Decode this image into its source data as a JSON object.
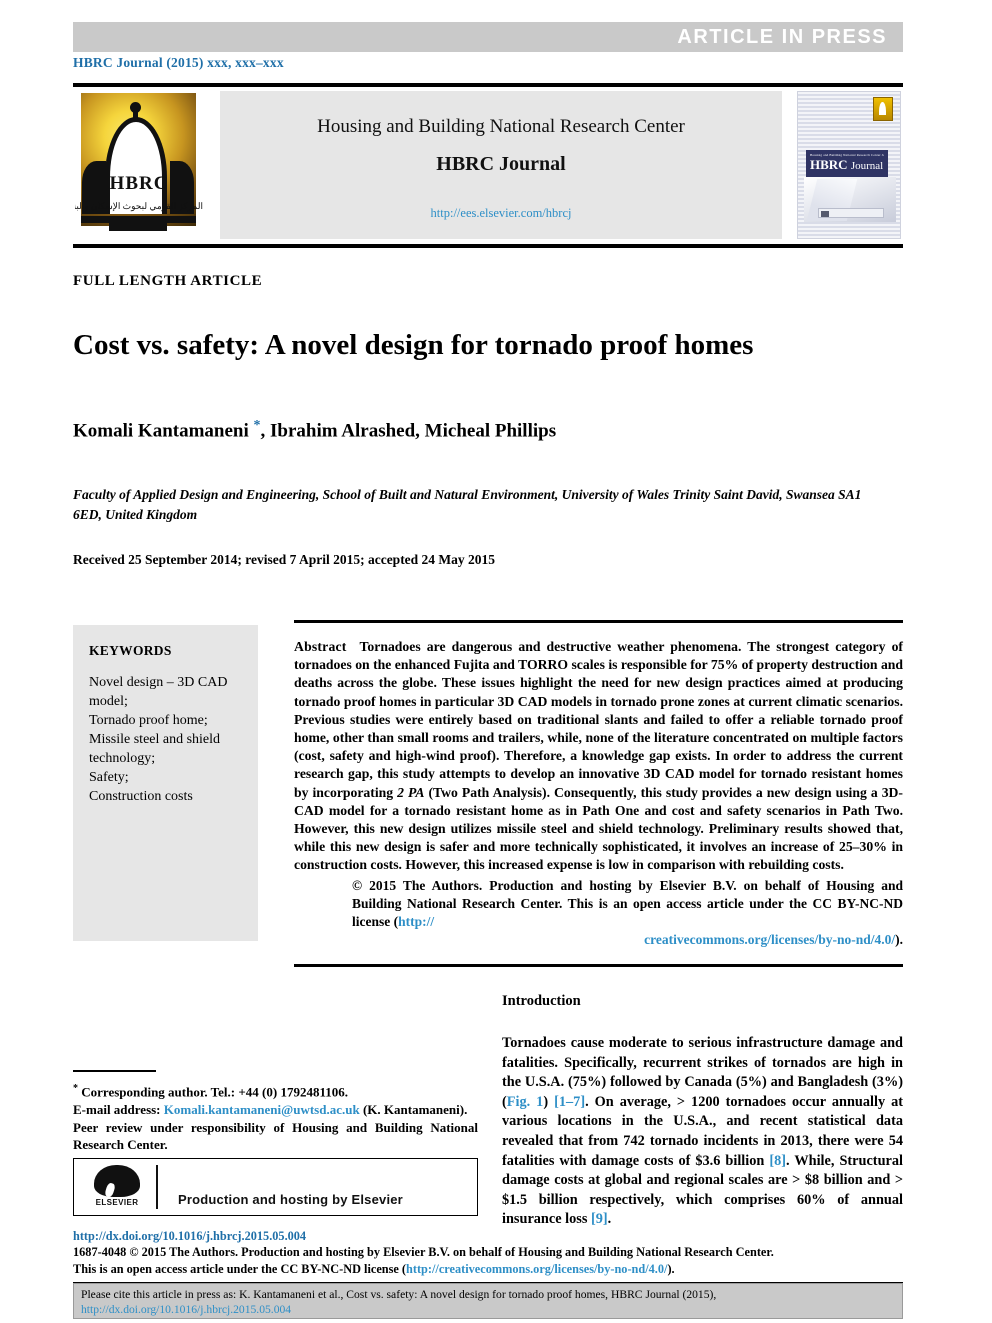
{
  "press_band": {
    "label": "ARTICLE  IN  PRESS"
  },
  "running_head": {
    "text": "HBRC Journal (2015) xxx, xxx–xxx"
  },
  "masthead": {
    "logo": {
      "acronym": "HBRC",
      "arabic": "المركز القومي لبحوث الإسكان والبناء"
    },
    "center_line1": "Housing and Building National Research Center",
    "center_line2": "HBRC Journal",
    "url": "http://ees.elsevier.com/hbrcj",
    "cover": {
      "small_line": "Housing and Building National Research Center Journal",
      "title_bold": "HBRC",
      "title_light": "Journal"
    }
  },
  "article": {
    "section_label": "FULL LENGTH ARTICLE",
    "title": "Cost vs. safety: A novel design for tornado proof homes",
    "authors_pre": "Komali Kantamaneni ",
    "authors_star": "*",
    "authors_post": ", Ibrahim Alrashed, Micheal Phillips",
    "affiliation": "Faculty of Applied Design and Engineering, School of Built and Natural Environment, University of Wales Trinity Saint David, Swansea SA1 6ED, United Kingdom",
    "history": "Received 25 September 2014; revised 7 April 2015; accepted 24 May 2015"
  },
  "keywords": {
    "heading": "KEYWORDS",
    "items": [
      "Novel design – 3D CAD model;",
      "Tornado proof home;",
      "Missile steel and shield technology;",
      "Safety;",
      "Construction costs"
    ]
  },
  "abstract": {
    "label": "Abstract",
    "p1_a": "Tornadoes are dangerous and destructive weather phenomena. The strongest category of tornadoes on the enhanced Fujita and TORRO scales is responsible for 75% of property destruction and deaths across the globe. These issues highlight the need for new design practices aimed at producing tornado proof homes in particular 3D CAD models in tornado prone zones at current climatic scenarios. Previous studies were entirely based on traditional slants and failed to offer a reliable tornado proof home, other than small rooms and trailers, while, none of the literature concentrated on multiple factors (cost, safety and high-wind proof). Therefore, a knowledge gap exists. In order to address the current research gap, this study attempts to develop an innovative 3D CAD model for tornado resistant homes by incorporating ",
    "p1_italic": "2 PA",
    "p1_b": " (Two Path Analysis). Consequently, this study provides a new design using a 3D-CAD model for a tornado resistant home as in Path One and cost and safety scenarios in Path Two. However, this new design utilizes missile steel and shield technology. Preliminary results showed that, while this new design is safer and more technically sophisticated, it involves an increase of 25–30% in construction costs. However, this increased expense is low in comparison with rebuilding costs.",
    "copyright_a": "© 2015 The Authors. Production and hosting by Elsevier B.V. on behalf of Housing and Building National Research Center.  This is an open access article under the CC BY-NC-ND license (",
    "copyright_link1": "http://",
    "copyright_link2": "creativecommons.org/licenses/by-no-nd/4.0/",
    "copyright_end": ")."
  },
  "introduction": {
    "heading": "Introduction",
    "p_a": "Tornadoes cause moderate to serious infrastructure damage and fatalities. Specifically, recurrent strikes of tornados are high in the U.S.A. (75%) followed by Canada (5%) and Bangladesh (3%) (",
    "fig_ref": "Fig. 1",
    "p_b": ") ",
    "ref_1_7": "[1–7]",
    "p_c": ". On average,  > 1200 tornadoes occur annually at various locations in the U.S.A., and recent statistical data revealed that from 742 tornado incidents in 2013, there were 54 fatalities with damage costs of $3.6 billion ",
    "ref_8": "[8]",
    "p_d": ". While, Structural damage costs at global and regional scales are  > $8 billion and  > $1.5 billion respectively, which comprises 60% of annual insurance loss ",
    "ref_9": "[9]",
    "p_e": "."
  },
  "footnote": {
    "corresponding": "Corresponding author. Tel.: +44 (0) 1792481106.",
    "email_label": "E-mail address: ",
    "email": "Komali.kantamaneni@uwtsd.ac.uk",
    "email_suffix": " (K. Kantamaneni).",
    "peer_review": "Peer review under responsibility of Housing and Building National Research Center.",
    "elsevier_caption": "Production and hosting by Elsevier",
    "elsevier_word": "ELSEVIER"
  },
  "bottom": {
    "doi": "http://dx.doi.org/10.1016/j.hbrcj.2015.05.004",
    "line1": "1687-4048 © 2015 The Authors. Production and hosting by Elsevier B.V. on behalf of Housing and Building National Research Center.",
    "line2_a": "This is an open access article under the CC BY-NC-ND license (",
    "line2_link": "http://creativecommons.org/licenses/by-no-nd/4.0/",
    "line2_b": ")."
  },
  "cite_bar": {
    "text_a": "Please cite this article in press as: K. Kantamaneni et al., Cost vs. safety: A novel design for tornado proof homes,  HBRC Journal (2015), ",
    "link": "http://dx.doi.org/10.1016/j.hbrcj.2015.05.004"
  },
  "colors": {
    "band_gray": "#c9c9c9",
    "panel_gray": "#e6e6e6",
    "link_blue": "#2e8fc7",
    "head_blue": "#1f6fa8",
    "cover_navy": "#2f3464"
  }
}
